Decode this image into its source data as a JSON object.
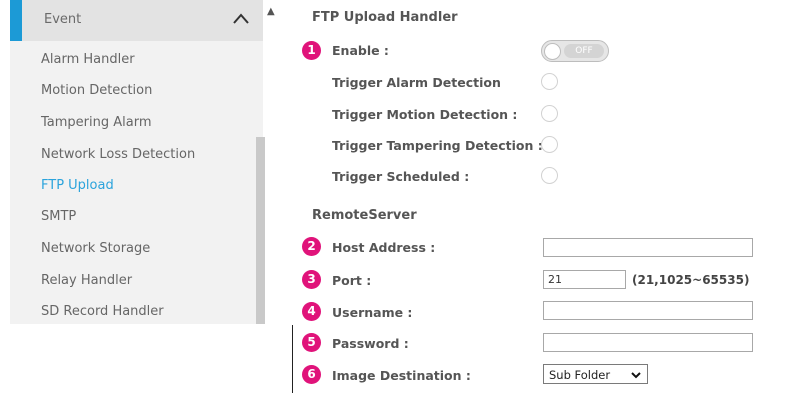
{
  "sidebar": {
    "header": "Event",
    "items": [
      {
        "label": "Alarm Handler"
      },
      {
        "label": "Motion Detection"
      },
      {
        "label": "Tampering Alarm"
      },
      {
        "label": "Network Loss Detection"
      },
      {
        "label": "FTP Upload",
        "active": true
      },
      {
        "label": "SMTP"
      },
      {
        "label": "Network Storage"
      },
      {
        "label": "Relay Handler"
      },
      {
        "label": "SD Record Handler"
      }
    ],
    "accent_color": "#1c9ad6"
  },
  "main": {
    "title": "FTP Upload Handler",
    "enable": {
      "badge": "1",
      "label": "Enable :",
      "state": "OFF"
    },
    "triggers": [
      {
        "label": "Trigger Alarm Detection"
      },
      {
        "label": "Trigger Motion Detection :"
      },
      {
        "label": "Trigger Tampering Detection :"
      },
      {
        "label": "Trigger Scheduled :"
      }
    ],
    "remote_server_title": "RemoteServer",
    "host": {
      "badge": "2",
      "label": "Host Address :",
      "value": ""
    },
    "port": {
      "badge": "3",
      "label": "Port :",
      "value": "21",
      "hint": "(21,1025~65535)"
    },
    "username": {
      "badge": "4",
      "label": "Username :",
      "value": ""
    },
    "password": {
      "badge": "5",
      "label": "Password :",
      "value": ""
    },
    "destination": {
      "badge": "6",
      "label": "Image Destination :",
      "value": "Sub Folder"
    },
    "badge_color": "#e0137a"
  }
}
